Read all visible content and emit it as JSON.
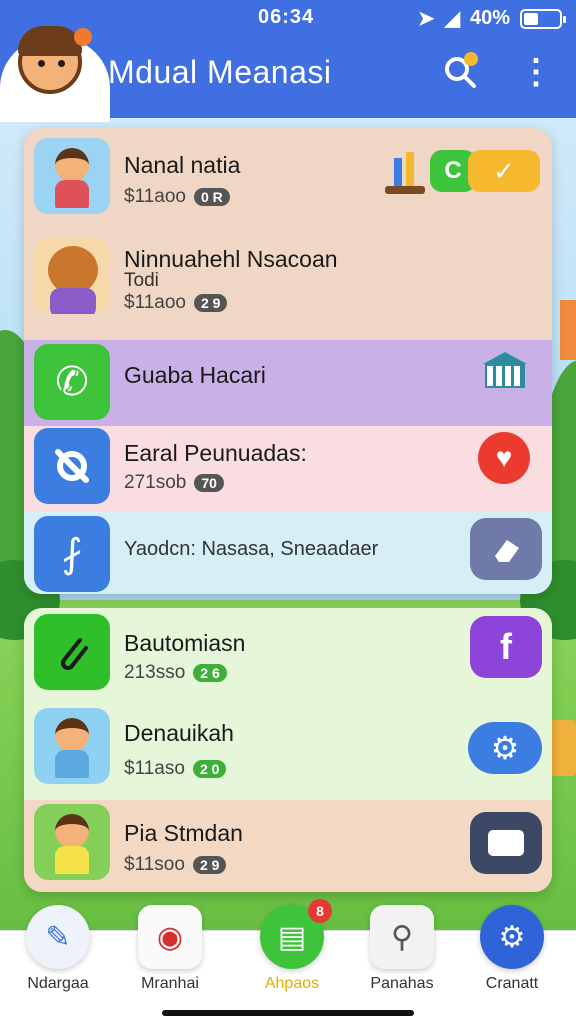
{
  "status_bar": {
    "time": "06:34",
    "battery": "40%",
    "battery_level": 0.4
  },
  "header": {
    "title": "Mdual Meanasi",
    "search_icon": "search-icon",
    "more_icon": "more-vertical-icon"
  },
  "list_top": [
    {
      "name": "Nanal natia",
      "meta": "$11aoo",
      "pill": "0 R",
      "thumb": "girl-avatar"
    },
    {
      "name": "Ninnuahehl Nsacoan",
      "sub": "Todi",
      "meta": "$11aoo",
      "pill": "2 9",
      "thumb": "boy-avatar"
    },
    {
      "name": "Guaba Hacari",
      "thumb": "phone-icon",
      "action_icon": "bank-icon"
    },
    {
      "name": "Earal Peunuadas:",
      "meta": "271sob",
      "pill": "70",
      "thumb": "link-icon",
      "action_icon": "heart-icon"
    },
    {
      "name": "Yaodcn: Nasasa, Sneaadaer",
      "thumb": "pin-icon",
      "action_icon": "eraser-icon"
    }
  ],
  "list_bottom": [
    {
      "name": "Bautomiasn",
      "meta": "213sso",
      "pill": "2 6",
      "thumb": "paperclip-icon",
      "action_icon": "facebook-icon",
      "action_label": "f"
    },
    {
      "name": "Denauikah",
      "meta": "$11aso",
      "pill": "2 0",
      "thumb": "girl-avatar",
      "action_icon": "settings-icon"
    },
    {
      "name": "Pia Stmdan",
      "meta": "$11soo",
      "pill": "2 9",
      "thumb": "dancer-avatar",
      "action_icon": "ticket-icon"
    }
  ],
  "top_tools": [
    "tools-icon",
    "chat-icon",
    "checkmark-icon"
  ],
  "bottom_nav": [
    {
      "label": "Ndargaa",
      "icon": "pencil-icon"
    },
    {
      "label": "Mranhai",
      "icon": "camera-icon"
    },
    {
      "label": "Ahpaos",
      "icon": "map-icon",
      "badge": "8",
      "active": true
    },
    {
      "label": "Panahas",
      "icon": "search-icon"
    },
    {
      "label": "Cranatt",
      "icon": "gear-icon"
    }
  ],
  "colors": {
    "header": "#3f6fe0",
    "card_top": "#f0d6c4",
    "row_purple": "#c9b1e8",
    "row_pink": "#f9dde0",
    "row_cyan": "#d6eef5",
    "card_bottom": "#e6f7d9",
    "green": "#3ec43a",
    "blue": "#3b7de0"
  }
}
